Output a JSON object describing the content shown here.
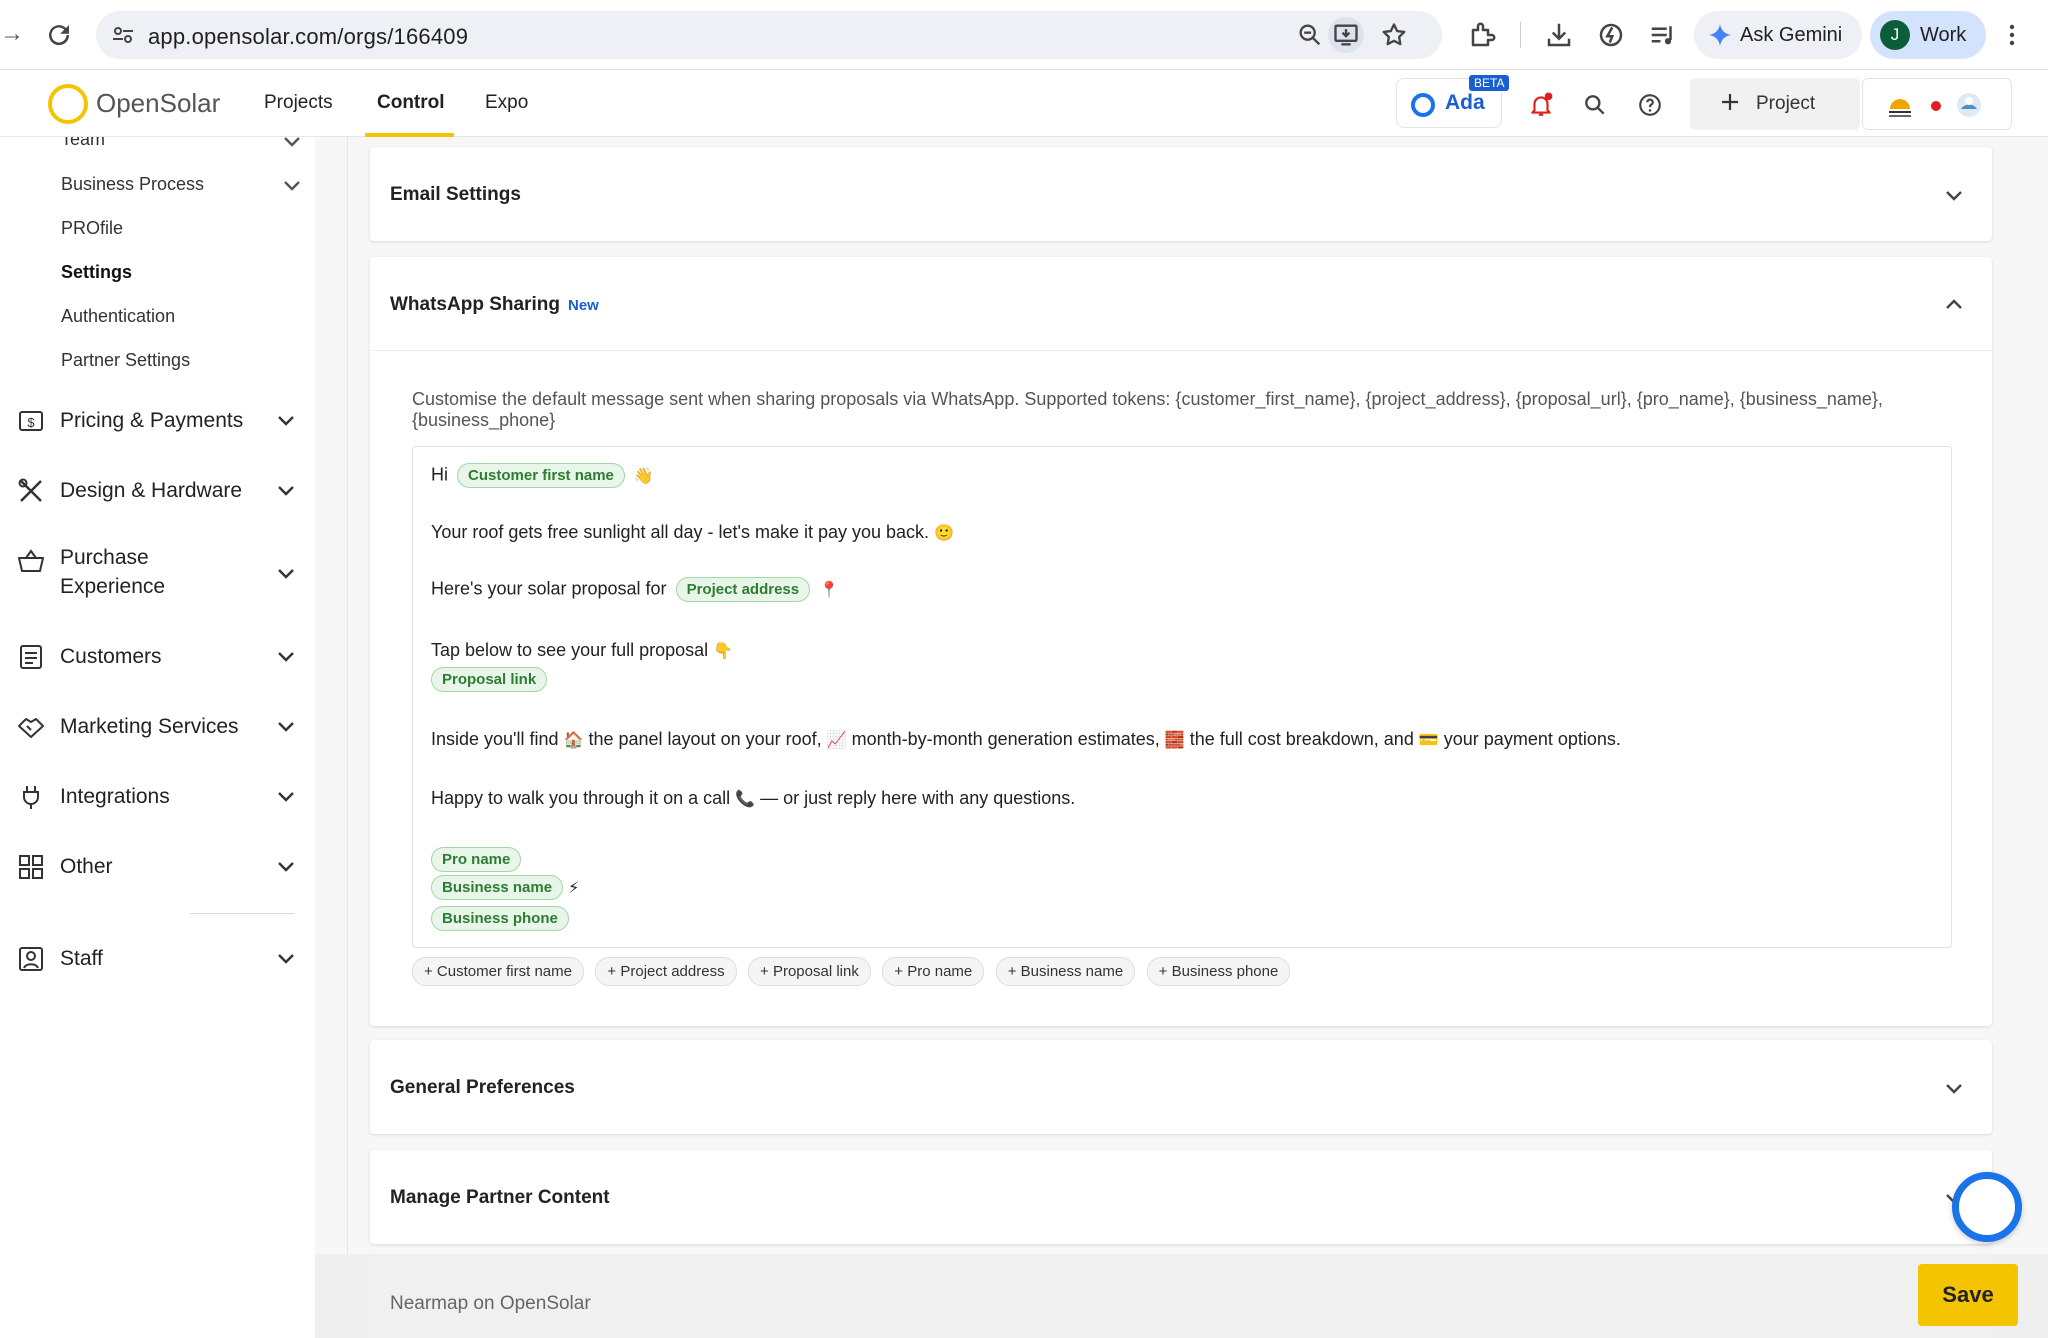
{
  "browser": {
    "url": "app.opensolar.com/orgs/166409",
    "gemini_label": "Ask Gemini",
    "profile_initial": "J",
    "profile_label": "Work"
  },
  "app": {
    "logo_text": "OpenSolar",
    "nav_tabs": [
      "Projects",
      "Control",
      "Expo"
    ],
    "active_tab": "Control",
    "ada_label": "Ada",
    "beta_label": "BETA",
    "project_button_label": "Project",
    "accent_color": "#f5c400",
    "brand_blue": "#1a5fd1"
  },
  "sidebar": {
    "sub_items": [
      "Team",
      "Business Process",
      "PROfile",
      "Settings",
      "Authentication",
      "Partner Settings"
    ],
    "active_sub_item": "Settings",
    "main_items": [
      {
        "label": "Pricing & Payments",
        "icon": "dollar-box-icon"
      },
      {
        "label": "Design & Hardware",
        "icon": "tools-icon"
      },
      {
        "label": "Purchase",
        "label2": "Experience",
        "icon": "basket-icon"
      },
      {
        "label": "Customers",
        "icon": "address-book-icon"
      },
      {
        "label": "Marketing Services",
        "icon": "handshake-icon"
      },
      {
        "label": "Integrations",
        "icon": "plug-icon"
      },
      {
        "label": "Other",
        "icon": "grid-icon"
      },
      {
        "label": "Staff",
        "icon": "badge-icon"
      }
    ]
  },
  "cards": {
    "email_settings": "Email Settings",
    "whatsapp": {
      "title": "WhatsApp Sharing",
      "badge": "New",
      "description": "Customise the default message sent when sharing proposals via WhatsApp. Supported tokens: {customer_first_name}, {project_address}, {proposal_url}, {pro_name}, {business_name}, {business_phone}",
      "message": {
        "greeting": "Hi",
        "line2": "Your roof gets free sunlight all day - let's make it pay you back.",
        "line3": "Here's your solar proposal for",
        "line4": "Tap below to see your full proposal",
        "line5_a": "Inside you'll find",
        "line5_b": "the panel layout on your roof,",
        "line5_c": "month-by-month generation estimates,",
        "line5_d": "the full cost breakdown, and",
        "line5_e": "your payment options.",
        "line6_a": "Happy to walk you through it on a call",
        "line6_b": "— or just reply here with any questions."
      },
      "tokens": {
        "customer_first_name": "Customer first name",
        "project_address": "Project address",
        "proposal_link": "Proposal link",
        "pro_name": "Pro name",
        "business_name": "Business name",
        "business_phone": "Business phone"
      },
      "emojis": {
        "wave": "👋",
        "smile": "🙂",
        "pin": "📍",
        "point_down": "👇",
        "house": "🏠",
        "chart": "📈",
        "bricks": "🧱",
        "card": "💳",
        "phone": "📞",
        "bolt": "⚡"
      },
      "insert_buttons": [
        "+ Customer first name",
        "+ Project address",
        "+ Proposal link",
        "+ Pro name",
        "+ Business name",
        "+ Business phone"
      ]
    },
    "general_preferences": "General Preferences",
    "manage_partner_content": "Manage Partner Content"
  },
  "footer": {
    "text": "Nearmap on OpenSolar",
    "save_label": "Save"
  }
}
